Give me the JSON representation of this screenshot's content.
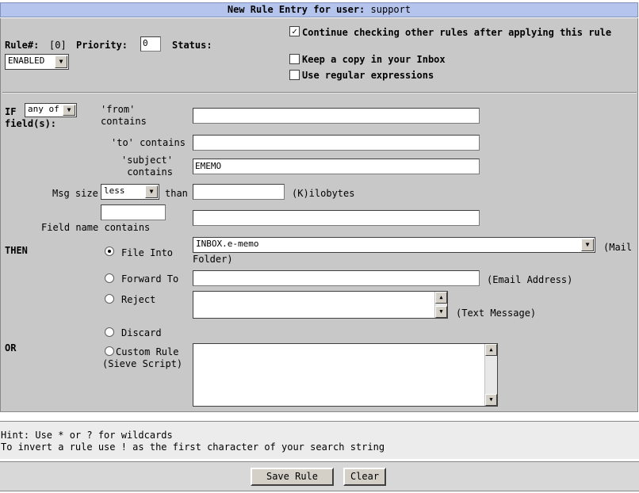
{
  "title": {
    "label": "New Rule Entry for user:",
    "user": "support"
  },
  "rule": {
    "number_label": "Rule#:",
    "number_value": "[0]",
    "priority_label": "Priority:",
    "priority_value": "0",
    "status_label": "Status:",
    "status_value": "ENABLED"
  },
  "options": {
    "continue_checking": "Continue checking other rules after applying this rule",
    "continue_checked": true,
    "keep_copy": "Keep a copy in your Inbox",
    "keep_checked": false,
    "use_regex": "Use regular expressions",
    "regex_checked": false
  },
  "conditions": {
    "if_label": "IF",
    "fields_label": "field(s):",
    "match_value": "any of",
    "from_label": "'from' contains",
    "from_value": "",
    "to_label": "'to' contains",
    "to_value": "",
    "subject_label": "'subject' contains",
    "subject_value": "EMEMO",
    "size_label": "Msg size",
    "size_op": "less",
    "than_label": "than",
    "size_value": "",
    "size_unit": "(K)ilobytes",
    "field_name_value": "",
    "field_name_label": "Field name contains",
    "field_contains_value": ""
  },
  "actions": {
    "then_label": "THEN",
    "file_into_label": "File Into",
    "file_into_value": "INBOX.e-memo",
    "mail_folder_label": "(Mail Folder)",
    "forward_label": "Forward To",
    "forward_value": "",
    "email_label": "(Email Address)",
    "reject_label": "Reject",
    "reject_value": "",
    "text_message_label": "(Text Message)",
    "discard_label": "Discard",
    "or_label": "OR",
    "custom_label": "Custom Rule",
    "sieve_label": "(Sieve Script)",
    "custom_value": "",
    "selected": "file_into"
  },
  "hint": {
    "line1": "Hint: Use * or ? for wildcards",
    "line2": "To invert a rule use ! as the first character of your search string"
  },
  "buttons": {
    "save": "Save Rule",
    "clear": "Clear"
  }
}
